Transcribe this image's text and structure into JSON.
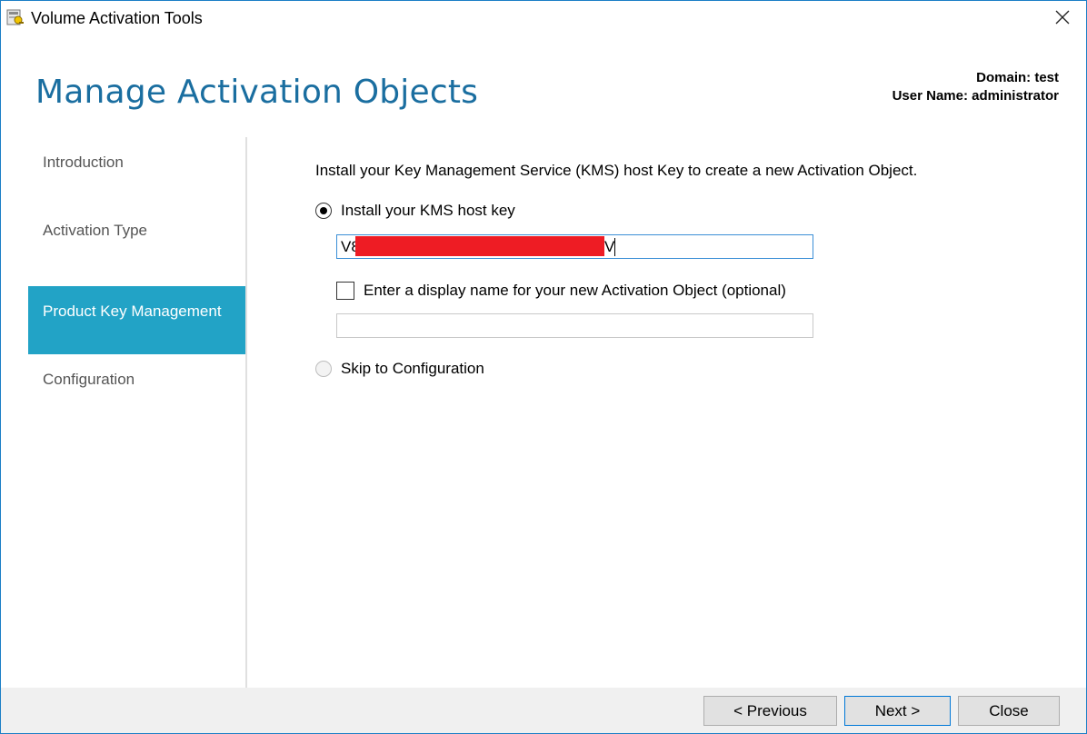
{
  "window": {
    "title": "Volume Activation Tools",
    "icon": "volume-activation-icon",
    "close_icon": "close-icon"
  },
  "header": {
    "title": "Manage Activation Objects",
    "domain_label": "Domain: test",
    "user_label": "User Name: administrator"
  },
  "nav": {
    "items": [
      {
        "label": "Introduction",
        "active": false
      },
      {
        "label": "Activation Type",
        "active": false
      },
      {
        "label": "Product Key Management",
        "active": true
      },
      {
        "label": "Configuration",
        "active": false
      }
    ]
  },
  "main": {
    "intro": "Install your Key Management Service (KMS) host Key to create a new Activation Object.",
    "install_option": {
      "label": "Install your KMS host key",
      "checked": true
    },
    "key_input": {
      "prefix": "V8",
      "suffix": "V",
      "redacted": true
    },
    "display_name_checkbox": {
      "label": "Enter a display name for your new Activation Object (optional)",
      "checked": false
    },
    "display_name_input": {
      "value": ""
    },
    "skip_option": {
      "label": "Skip to Configuration",
      "checked": false,
      "disabled": true
    }
  },
  "footer": {
    "previous": "< Previous",
    "next": "Next >",
    "close": "Close"
  },
  "colors": {
    "accent": "#22a3c6",
    "title": "#1a6ea0",
    "redaction": "#ee1c24"
  }
}
